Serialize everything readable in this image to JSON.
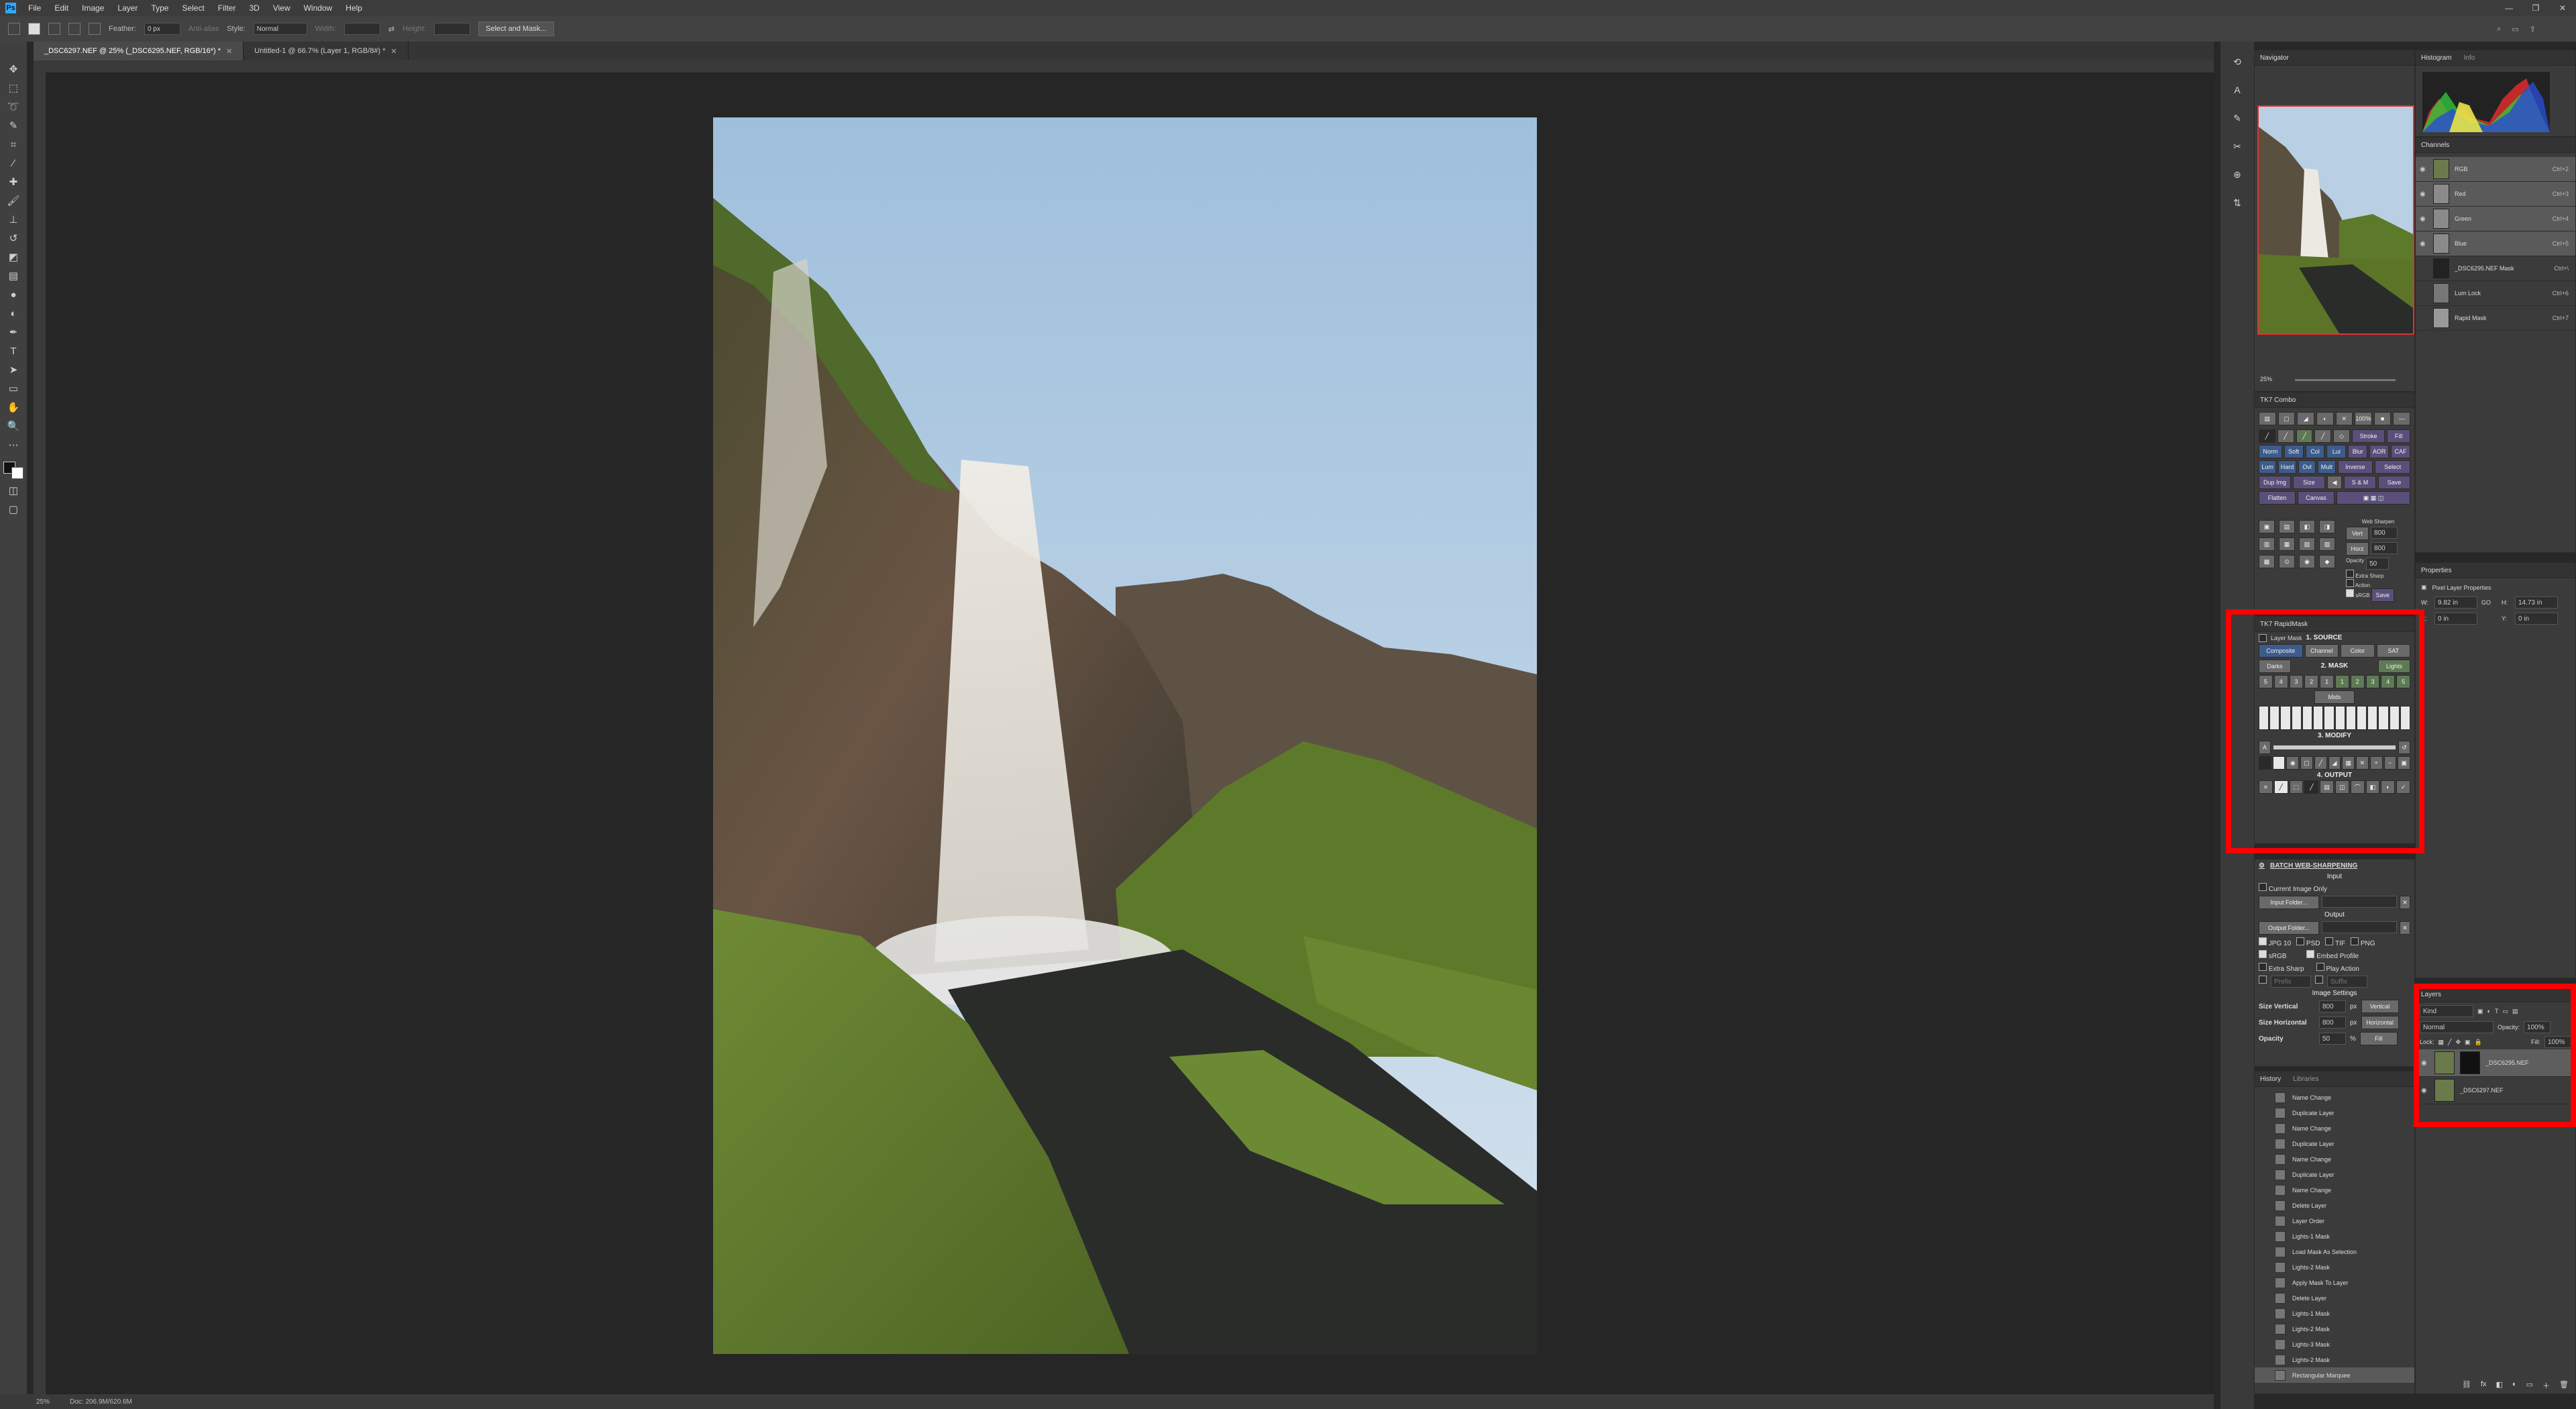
{
  "app": {
    "logo": "Ps"
  },
  "menu": [
    "File",
    "Edit",
    "Image",
    "Layer",
    "Type",
    "Select",
    "Filter",
    "3D",
    "View",
    "Window",
    "Help"
  ],
  "window_controls": [
    "—",
    "❐",
    "✕"
  ],
  "options": {
    "feather_label": "Feather:",
    "feather_value": "0 px",
    "antialias_label": "Anti-alias",
    "style_label": "Style:",
    "style_value": "Normal",
    "width_label": "Width:",
    "height_label": "Height:",
    "select_mask_label": "Select and Mask..."
  },
  "tabs": [
    {
      "label": "_DSC6297.NEF @ 25% (_DSC6295.NEF, RGB/16*) *"
    },
    {
      "label": "Untitled-1 @ 66.7% (Layer 1, RGB/8#) *"
    }
  ],
  "status": {
    "zoom": "25%",
    "doc": "Doc: 206.9M/620.6M"
  },
  "navigator": {
    "title": "Navigator",
    "zoom": "25%"
  },
  "histogram": {
    "title": "Histogram",
    "tab2": "Info"
  },
  "channels": {
    "title": "Channels",
    "rows": [
      {
        "name": "RGB",
        "shortcut": "Ctrl+2"
      },
      {
        "name": "Red",
        "shortcut": "Ctrl+3"
      },
      {
        "name": "Green",
        "shortcut": "Ctrl+4"
      },
      {
        "name": "Blue",
        "shortcut": "Ctrl+5"
      },
      {
        "name": "_DSC6295.NEF Mask",
        "shortcut": "Ctrl+\\"
      },
      {
        "name": "Lum Lock",
        "shortcut": "Ctrl+6"
      },
      {
        "name": "Rapid Mask",
        "shortcut": "Ctrl+7"
      }
    ]
  },
  "tkcombo": {
    "title": "TK7 Combo",
    "row1": [
      "",
      "",
      "",
      "",
      "",
      "100%",
      "",
      ""
    ],
    "row2": [
      "",
      "",
      "",
      "",
      "",
      "Stroke",
      "Fill"
    ],
    "row3": [
      "Norm",
      "Soft",
      "Col",
      "Lui",
      "Blur",
      "AOR",
      "CAF"
    ],
    "row4": [
      "Lum",
      "Hard",
      "Ovl",
      "Mult",
      "Inverse",
      "Select"
    ],
    "row5": [
      "Dup Img",
      "Size",
      "",
      "S & M",
      "Save"
    ],
    "row6": [
      "Flatten",
      "Canvas",
      "",
      ""
    ],
    "web": {
      "title": "Web Sharpen",
      "vert": "Vert",
      "horz": "Horz",
      "v": "800",
      "h": "800",
      "fill_label": "Opacity",
      "opacity": "50",
      "extra": "Extra Sharp",
      "action": "Action",
      "srgb": "sRGB",
      "save": "Save"
    }
  },
  "rapidmask": {
    "title": "TK7 RapidMask",
    "layer_mask": "Layer Mask",
    "source": "1. SOURCE",
    "src_btns": [
      "Composite",
      "Channel",
      "Color",
      "SAT"
    ],
    "mask": "2. MASK",
    "darks": "Darks",
    "lights": "Lights",
    "nums_left": [
      "5",
      "4",
      "3",
      "2",
      "1"
    ],
    "nums_right": [
      "1",
      "2",
      "3",
      "4",
      "5"
    ],
    "mids": "Mids",
    "modify": "3. MODIFY",
    "output": "4. OUTPUT"
  },
  "batch": {
    "title": "BATCH WEB-SHARPENING",
    "input": "Input",
    "current_only": "Current Image Only",
    "input_folder": "Input Folder...",
    "output": "Output",
    "output_folder": "Output Folder...",
    "formats": [
      "JPG",
      "PSD",
      "TIF",
      "PNG"
    ],
    "quality": "10",
    "srgb": "sRGB",
    "embed": "Embed Profile",
    "extra": "Extra Sharp",
    "play": "Play Action",
    "prefix": "Prefix",
    "suffix": "Suffix",
    "image_settings": "Image Settings",
    "size_v": "Size Vertical",
    "size_h": "Size Horizontal",
    "opacity": "Opacity",
    "v": "800",
    "h": "800",
    "op": "50",
    "px": "px",
    "pct": "%",
    "vertical": "Vertical",
    "horizontal": "Horizontal",
    "fill": "Fill"
  },
  "history": {
    "title": "History",
    "tab2": "Libraries",
    "rows": [
      "Name Change",
      "Duplicate Layer",
      "Name Change",
      "Duplicate Layer",
      "Name Change",
      "Duplicate Layer",
      "Name Change",
      "Delete Layer",
      "Layer Order",
      "Lights-1 Mask",
      "Load Mask As Selection",
      "Lights-2 Mask",
      "Apply Mask To Layer",
      "Delete Layer",
      "Lights-1 Mask",
      "Lights-2 Mask",
      "Lights-3 Mask",
      "Lights-2 Mask",
      "Rectangular Marquee"
    ]
  },
  "properties": {
    "title": "Properties",
    "subtitle": "Pixel Layer Properties",
    "w": "9.82 in",
    "h": "14.73 in",
    "x": "0 in",
    "y": "0 in",
    "w_lbl": "W:",
    "h_lbl": "H:",
    "x_lbl": "X:",
    "y_lbl": "Y:",
    "go": "GO"
  },
  "layers": {
    "title": "Layers",
    "kind": "Kind",
    "blend": "Normal",
    "opacity_lbl": "Opacity:",
    "opacity": "100%",
    "lock_lbl": "Lock:",
    "fill_lbl": "Fill:",
    "fill": "100%",
    "rows": [
      {
        "name": "_DSC6295.NEF"
      },
      {
        "name": "_DSC6297.NEF"
      }
    ]
  }
}
